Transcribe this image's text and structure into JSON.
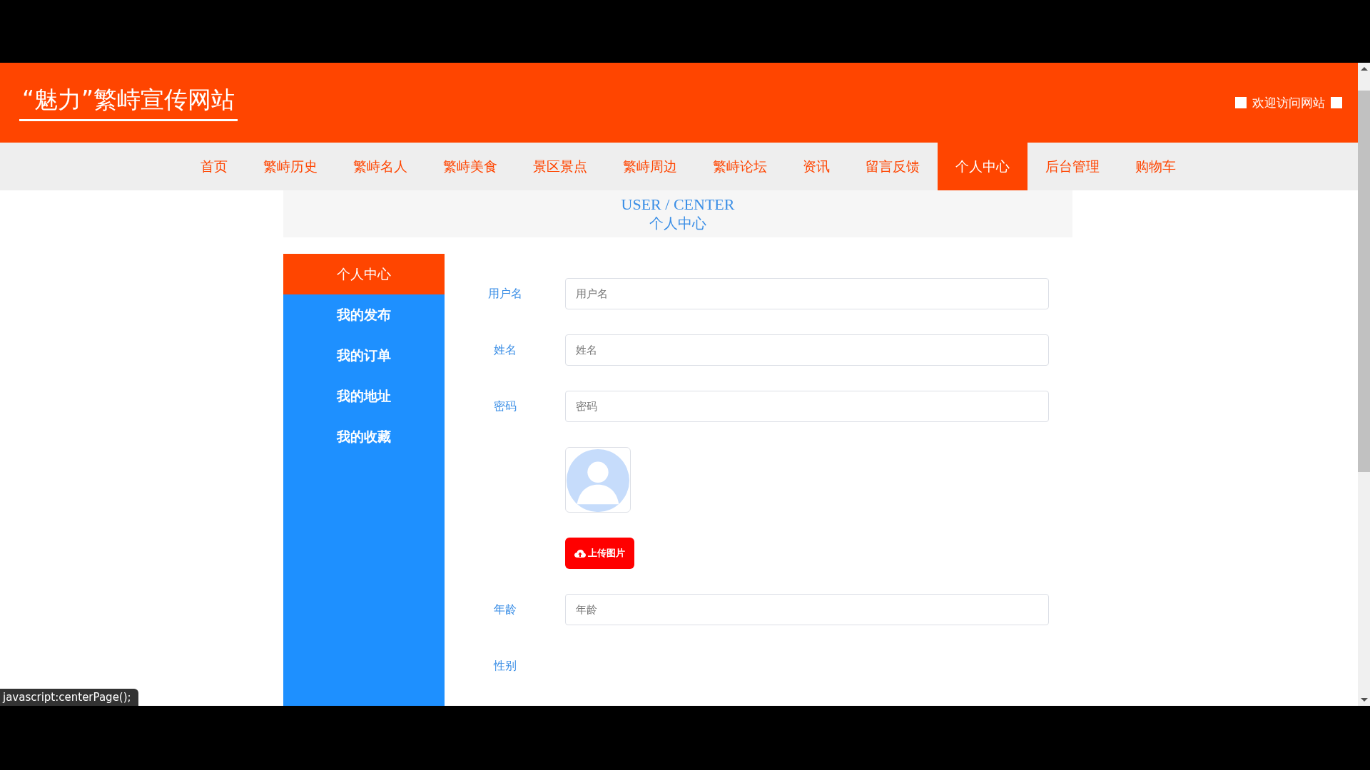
{
  "header": {
    "site_title": "“魅力”繁峙宣传网站",
    "welcome": "欢迎访问网站"
  },
  "nav": [
    {
      "label": "首页",
      "selected": false
    },
    {
      "label": "繁峙历史",
      "selected": false
    },
    {
      "label": "繁峙名人",
      "selected": false
    },
    {
      "label": "繁峙美食",
      "selected": false
    },
    {
      "label": "景区景点",
      "selected": false
    },
    {
      "label": "繁峙周边",
      "selected": false
    },
    {
      "label": "繁峙论坛",
      "selected": false
    },
    {
      "label": "资讯",
      "selected": false
    },
    {
      "label": "留言反馈",
      "selected": false
    },
    {
      "label": "个人中心",
      "selected": true
    },
    {
      "label": "后台管理",
      "selected": false
    },
    {
      "label": "购物车",
      "selected": false
    }
  ],
  "banner": {
    "title_en": "USER / CENTER",
    "title": "个人中心"
  },
  "sidebar": [
    {
      "label": "个人中心",
      "selected": true
    },
    {
      "label": "我的发布",
      "selected": false
    },
    {
      "label": "我的订单",
      "selected": false
    },
    {
      "label": "我的地址",
      "selected": false
    },
    {
      "label": "我的收藏",
      "selected": false
    }
  ],
  "form": [
    {
      "kind": "input",
      "label": "用户名",
      "placeholder": "用户名"
    },
    {
      "kind": "input",
      "label": "姓名",
      "placeholder": "姓名"
    },
    {
      "kind": "input",
      "label": "密码",
      "placeholder": "密码"
    },
    {
      "kind": "avatar"
    },
    {
      "kind": "upload",
      "button": "上传图片"
    },
    {
      "kind": "input",
      "label": "年龄",
      "placeholder": "年龄"
    },
    {
      "kind": "label",
      "label": "性别"
    }
  ],
  "status_text": "javascript:centerPage();"
}
